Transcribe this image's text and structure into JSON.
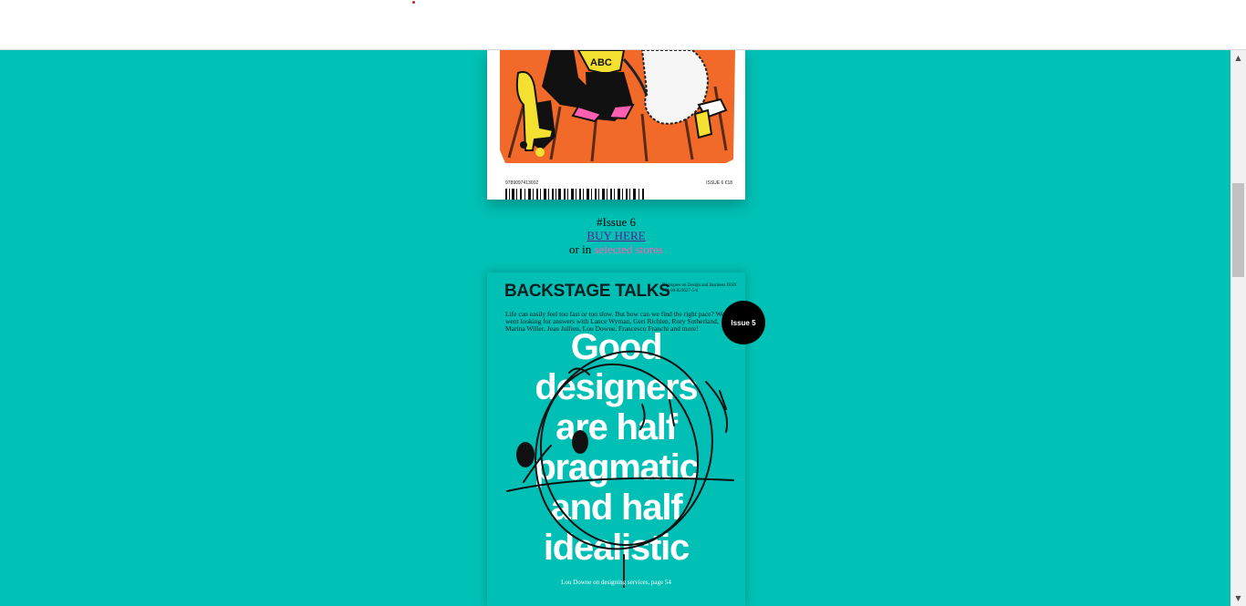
{
  "caption": {
    "issue_title": "#Issue 6",
    "buy_link": "BUY HERE",
    "or_in": "or in",
    "stores_link": "selected stores"
  },
  "cover6": {
    "isbn": "9789097413002",
    "issue_price": "ISSUE 6  €18"
  },
  "cover5": {
    "brand": "BACKSTAGE TALKS",
    "subtitle": "Dialogues on Design and Business ISSN 978-90-823627-5-0",
    "blurb": "Life can easily feel too fast or too slow. But how can we find the right pace? We went looking for answers with Lance Wyman, Geri Richlen, Rory Sutherland, Marina Willer, Jean Jullien, Lou Downe, Francesco Franchi and more!",
    "headline_lines": [
      "Good",
      "designers",
      "are half",
      "pragmatic",
      "and half",
      "idealistic"
    ],
    "footer": "Lou Downe on designing services, page 54"
  },
  "badge": {
    "label": "Issue 5"
  },
  "scrollbar": {
    "up_icon": "▲",
    "down_icon": "▼"
  },
  "colors": {
    "background": "#00c1b5",
    "badge": "#000000",
    "link": "#5a1e8c",
    "stores": "#ff5fb0"
  }
}
